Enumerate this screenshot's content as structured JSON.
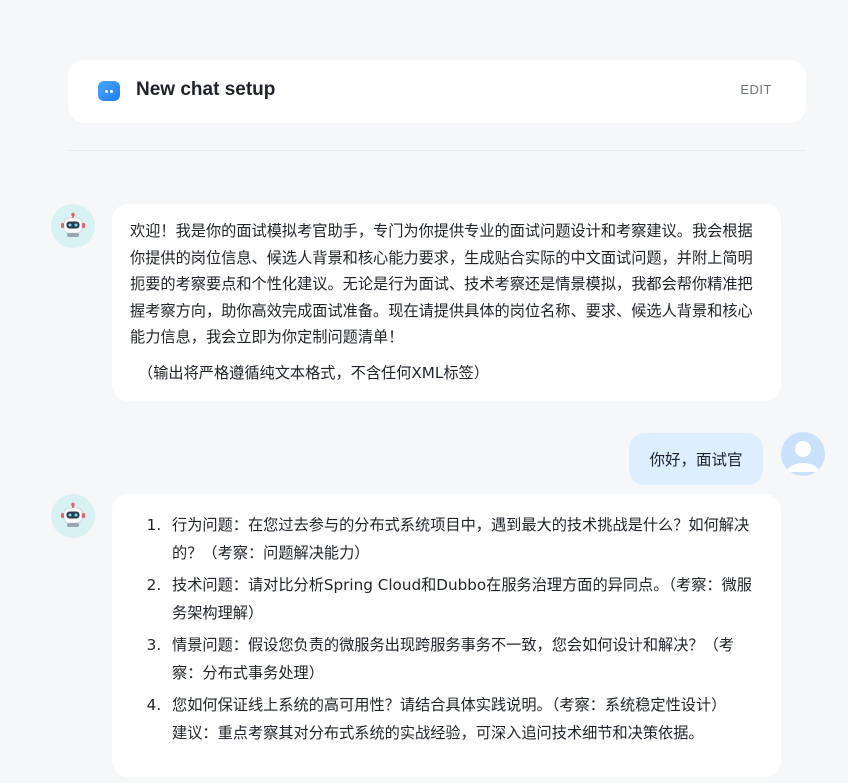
{
  "setup": {
    "title": "New chat setup",
    "edit_label": "EDIT",
    "icon": "chat-bot-icon"
  },
  "messages": {
    "bot_intro": {
      "avatar": "robot-avatar",
      "paragraph": "欢迎！我是你的面试模拟考官助手，专门为你提供专业的面试问题设计和考察建议。我会根据你提供的岗位信息、候选人背景和核心能力要求，生成贴合实际的中文面试问题，并附上简明扼要的考察要点和个性化建议。无论是行为面试、技术考察还是情景模拟，我都会帮你精准把握考察方向，助你高效完成面试准备。现在请提供具体的岗位名称、要求、候选人背景和核心能力信息，我会立即为你定制问题清单！",
      "note": "（输出将严格遵循纯文本格式，不含任何XML标签）"
    },
    "user": {
      "avatar": "user-avatar",
      "text": "你好，面试官"
    },
    "bot_questions": {
      "avatar": "robot-avatar",
      "items": [
        "行为问题：在您过去参与的分布式系统项目中，遇到最大的技术挑战是什么？如何解决的？（考察：问题解决能力）",
        "技术问题：请对比分析Spring Cloud和Dubbo在服务治理方面的异同点。（考察：微服务架构理解）",
        "情景问题：假设您负责的微服务出现跨服务事务不一致，您会如何设计和解决？（考察：分布式事务处理）",
        "您如何保证线上系统的高可用性？请结合具体实践说明。（考察：系统稳定性设计）"
      ],
      "suggestion": "建议：重点考察其对分布式系统的实战经验，可深入追问技术细节和决策依据。"
    }
  },
  "colors": {
    "background": "#f6f7f9",
    "bot_bubble": "#ffffff",
    "user_bubble": "#ddeeff",
    "accent": "#1f7cf2"
  }
}
